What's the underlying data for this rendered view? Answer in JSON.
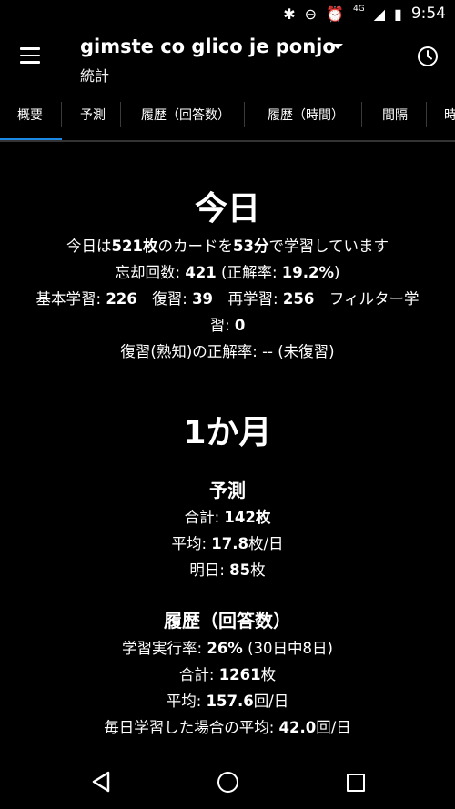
{
  "status": {
    "time": "9:54",
    "network": "4G"
  },
  "appbar": {
    "title": "gimste co glico je ponjo",
    "subtitle": "統計"
  },
  "tabs": [
    "概要",
    "予測",
    "履歴（回答数）",
    "履歴（時間）",
    "間隔",
    "時"
  ],
  "today": {
    "heading": "今日",
    "l1": {
      "a": "今日は",
      "b": "521枚",
      "c": "のカードを",
      "d": "53分",
      "e": "で学習しています"
    },
    "l2": {
      "a": "忘却回数: ",
      "b": "421",
      "c": " (正解率: ",
      "d": "19.2%",
      "e": ")"
    },
    "l3": {
      "a": "基本学習: ",
      "b": "226",
      "c": "　復習: ",
      "d": "39",
      "e": "　再学習: ",
      "f": "256",
      "g": "　フィルター学"
    },
    "l4": {
      "a": "習: ",
      "b": "0"
    },
    "l5": "復習(熟知)の正解率: -- (未復習)"
  },
  "month": {
    "heading": "1か月",
    "forecast": {
      "heading": "予測",
      "total": {
        "a": "合計: ",
        "b": "142枚"
      },
      "average": {
        "a": "平均: ",
        "b": "17.8",
        "c": "枚/日"
      },
      "tomorrow": {
        "a": "明日: ",
        "b": "85",
        "c": "枚"
      }
    },
    "history": {
      "heading": "履歴（回答数）",
      "rate": {
        "a": "学習実行率: ",
        "b": "26%",
        "c": " (30日中8日)"
      },
      "total": {
        "a": "合計: ",
        "b": "1261",
        "c": "枚"
      },
      "average": {
        "a": "平均: ",
        "b": "157.6",
        "c": "回/日"
      },
      "if_daily": {
        "a": "毎日学習した場合の平均: ",
        "b": "42.0",
        "c": "回/日"
      }
    }
  }
}
